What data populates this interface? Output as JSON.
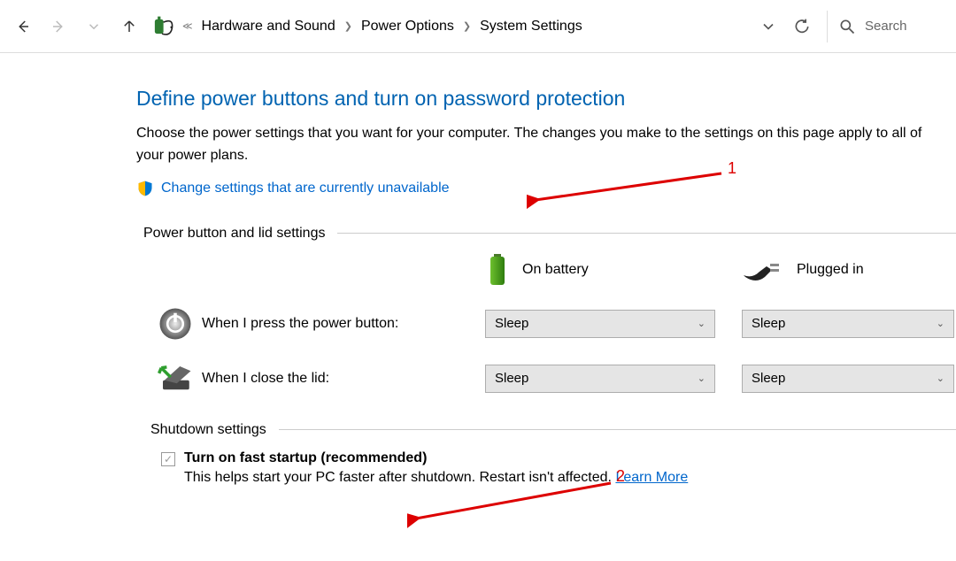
{
  "breadcrumb": {
    "items": [
      "Hardware and Sound",
      "Power Options",
      "System Settings"
    ]
  },
  "search": {
    "placeholder": "Search"
  },
  "title": "Define power buttons and turn on password protection",
  "description": "Choose the power settings that you want for your computer. The changes you make to the settings on this page apply to all of your power plans.",
  "change_link": "Change settings that are currently unavailable",
  "sections": {
    "power_lid_title": "Power button and lid settings",
    "shutdown_title": "Shutdown settings"
  },
  "columns": {
    "battery": "On battery",
    "plugged": "Plugged in"
  },
  "rows": {
    "power_button": {
      "label": "When I press the power button:",
      "battery": "Sleep",
      "plugged": "Sleep"
    },
    "close_lid": {
      "label": "When I close the lid:",
      "battery": "Sleep",
      "plugged": "Sleep"
    }
  },
  "shutdown": {
    "fast_startup_label": "Turn on fast startup (recommended)",
    "fast_startup_checked": true,
    "fast_startup_help": "This helps start your PC faster after shutdown. Restart isn't affected.",
    "learn_more": "Learn More"
  },
  "annotations": {
    "n1": "1",
    "n2": "2"
  }
}
